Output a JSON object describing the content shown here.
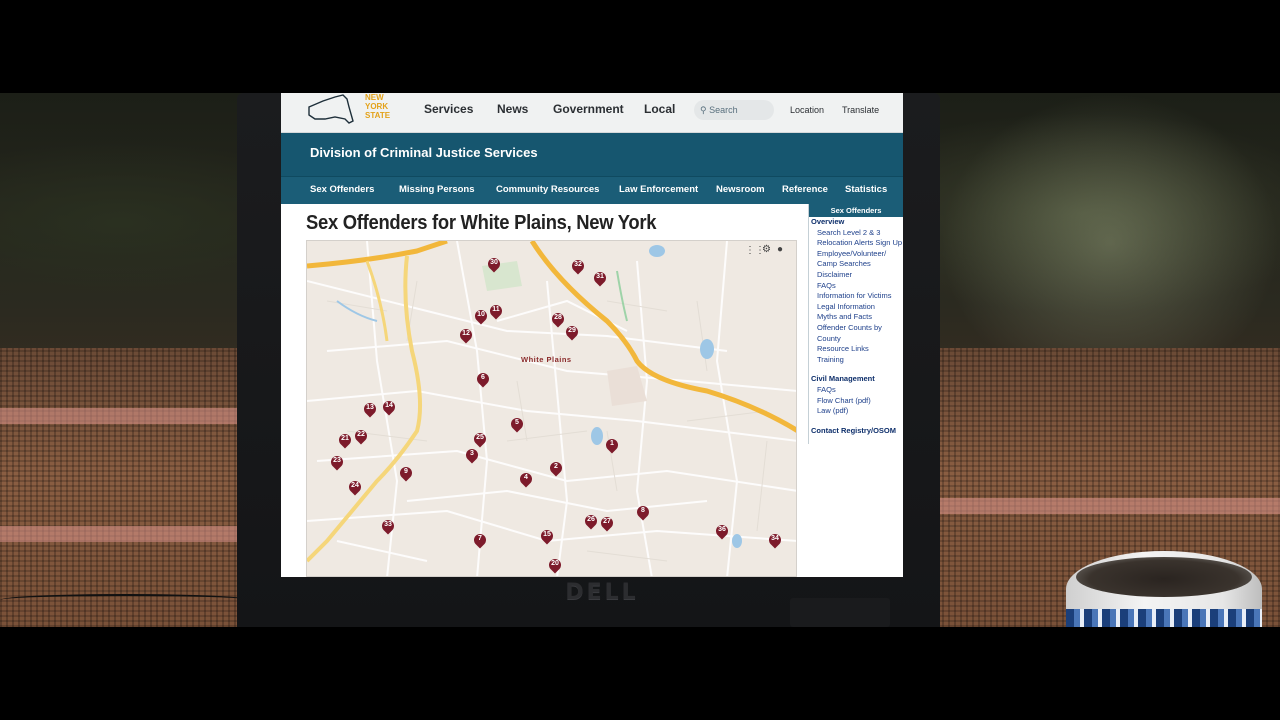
{
  "brand": {
    "logo_lines": [
      "NEW",
      "YORK",
      "STATE"
    ]
  },
  "top_nav": {
    "items": [
      "Services",
      "News",
      "Government",
      "Local"
    ]
  },
  "search": {
    "placeholder": "Search"
  },
  "top_links": {
    "location": "Location",
    "translate": "Translate"
  },
  "division_title": "Division of Criminal Justice Services",
  "sub_nav": [
    "Sex Offenders",
    "Missing Persons",
    "Community Resources",
    "Law Enforcement",
    "Newsroom",
    "Reference",
    "Statistics"
  ],
  "page_title": "Sex Offenders for White Plains, New York",
  "map": {
    "city_label": "White Plains",
    "pins": [
      "30",
      "32",
      "31",
      "11",
      "10",
      "28",
      "29",
      "12",
      "6",
      "13",
      "14",
      "5",
      "22",
      "21",
      "25",
      "3",
      "1",
      "23",
      "2",
      "9",
      "4",
      "24",
      "33",
      "8",
      "26",
      "27",
      "15",
      "7",
      "36",
      "34",
      "20"
    ]
  },
  "sidebar": {
    "header": "Sex Offenders",
    "links": [
      "Overview",
      "Search Level 2 & 3",
      "Relocation Alerts Sign Up",
      "Employee/Volunteer/",
      "Camp Searches",
      "Disclaimer",
      "FAQs",
      "Information for Victims",
      "Legal Information",
      "Myths and Facts",
      "Offender Counts by",
      "County",
      "Resource Links",
      "Training"
    ],
    "civil_header": "Civil Management",
    "civil_links": [
      "FAQs",
      "Flow Chart (pdf)",
      "Law (pdf)"
    ],
    "contact": "Contact Registry/OSOM"
  },
  "hardware": {
    "laptop_brand": "DELL"
  }
}
